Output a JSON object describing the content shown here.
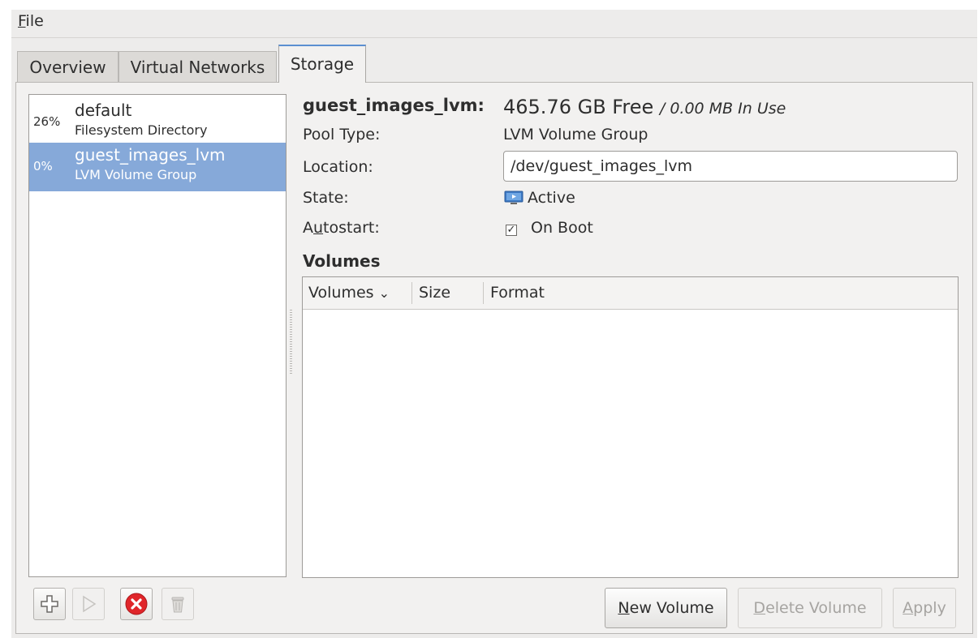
{
  "menubar": {
    "file_first": "F",
    "file_rest": "ile"
  },
  "tabs": [
    {
      "label": "Overview"
    },
    {
      "label": "Virtual Networks"
    },
    {
      "label": "Storage"
    }
  ],
  "pools": [
    {
      "percent": "26%",
      "name": "default",
      "type": "Filesystem Directory"
    },
    {
      "percent": "0%",
      "name": "guest_images_lvm",
      "type": "LVM Volume Group"
    }
  ],
  "details": {
    "pool_name": "guest_images_lvm:",
    "free": "465.76 GB Free",
    "in_use": "/ 0.00 MB In Use",
    "pool_type_label": "Pool Type:",
    "pool_type_value": "LVM Volume Group",
    "location_label": "Location:",
    "location_value": "/dev/guest_images_lvm",
    "state_label": "State:",
    "state_value": "Active",
    "autostart_label_pre": "A",
    "autostart_label_ul": "u",
    "autostart_label_post": "tostart:",
    "autostart_value": "On Boot",
    "autostart_checked": "✓",
    "volumes_heading": "Volumes"
  },
  "volumes_table": {
    "columns": [
      "Volumes",
      "Size",
      "Format"
    ],
    "sort_indicator": "⌄"
  },
  "buttons": {
    "new_volume_ul": "N",
    "new_volume_rest": "ew Volume",
    "delete_volume_ul": "D",
    "delete_volume_rest": "elete Volume",
    "apply_ul": "A",
    "apply_rest": "pply"
  },
  "icons": {
    "add": "plus-icon",
    "start": "play-icon",
    "stop": "stop-icon",
    "delete": "trash-icon",
    "state": "monitor-icon"
  },
  "colors": {
    "selection": "#86a9d9",
    "stop_red": "#e0262a",
    "tab_accent": "#5b8fd1"
  }
}
